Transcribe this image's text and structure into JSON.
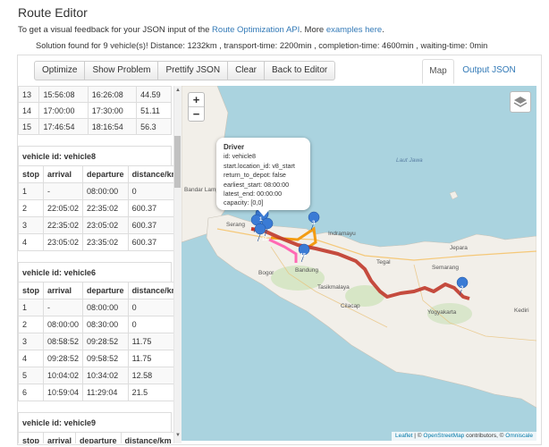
{
  "header": {
    "title": "Route Editor",
    "intro_prefix": "To get a visual feedback for your JSON input of the ",
    "intro_link": "Route Optimization API",
    "intro_mid": ". More ",
    "intro_link2": "examples here",
    "intro_suffix": ".",
    "summary": "Solution found for 9 vehicle(s)! Distance: 1232km , transport-time: 2200min , completion-time: 4600min , waiting-time: 0min"
  },
  "toolbar": {
    "optimize": "Optimize",
    "show_problem": "Show Problem",
    "prettify": "Prettify JSON",
    "clear": "Clear",
    "back": "Back to Editor"
  },
  "tabs": {
    "map": "Map",
    "output": "Output JSON"
  },
  "top_rows": [
    [
      "13",
      "15:56:08",
      "16:26:08",
      "44.59"
    ],
    [
      "14",
      "17:00:00",
      "17:30:00",
      "51.11"
    ],
    [
      "15",
      "17:46:54",
      "18:16:54",
      "56.3"
    ]
  ],
  "columns": [
    "stop",
    "arrival",
    "departure",
    "distance/km"
  ],
  "vehicle8": {
    "title": "vehicle id: vehicle8",
    "rows": [
      [
        "1",
        "-",
        "08:00:00",
        "0"
      ],
      [
        "2",
        "22:05:02",
        "22:35:02",
        "600.37"
      ],
      [
        "3",
        "22:35:02",
        "23:05:02",
        "600.37"
      ],
      [
        "4",
        "23:05:02",
        "23:35:02",
        "600.37"
      ]
    ]
  },
  "vehicle6": {
    "title": "vehicle id: vehicle6",
    "rows": [
      [
        "1",
        "-",
        "08:00:00",
        "0"
      ],
      [
        "2",
        "08:00:00",
        "08:30:00",
        "0"
      ],
      [
        "3",
        "08:58:52",
        "09:28:52",
        "11.75"
      ],
      [
        "4",
        "09:28:52",
        "09:58:52",
        "11.75"
      ],
      [
        "5",
        "10:04:02",
        "10:34:02",
        "12.58"
      ],
      [
        "6",
        "10:59:04",
        "11:29:04",
        "21.5"
      ]
    ]
  },
  "vehicle9": {
    "title": "vehicle id: vehicle9"
  },
  "map": {
    "popup": {
      "title": "Driver",
      "lines": [
        "id: vehicle8",
        "start.location_id: v8_start",
        "return_to_depot: false",
        "earliest_start: 08:00:00",
        "latest_end: 00:00:00",
        "capacity: [0,0]"
      ]
    },
    "labels": {
      "lampung": "Bandar Lampung",
      "serang": "Serang",
      "bogor": "Bogor",
      "bandung": "Bandung",
      "indramayu": "Indramayu",
      "tegal": "Tegal",
      "semarang": "Semarang",
      "jepara": "Jepara",
      "tasikmalaya": "Tasikmalaya",
      "cilacap": "Cilacap",
      "yogyakarta": "Yogyakarta",
      "kediri": "Kediri",
      "sea": "Laut Jawa"
    },
    "markers": {
      "m1": "1",
      "m2": "2",
      "m3": "3",
      "m15": "15",
      "m16": "15"
    },
    "zoom_in": "+",
    "zoom_out": "−",
    "attribution": {
      "leaflet": "Leaflet",
      "sep1": " | © ",
      "osm": "OpenStreetMap",
      "mid": " contributors, © ",
      "omniscale": "Omniscale"
    },
    "route_color": "#c0392b",
    "water_color": "#aad3df",
    "land_color": "#f2efe9"
  }
}
